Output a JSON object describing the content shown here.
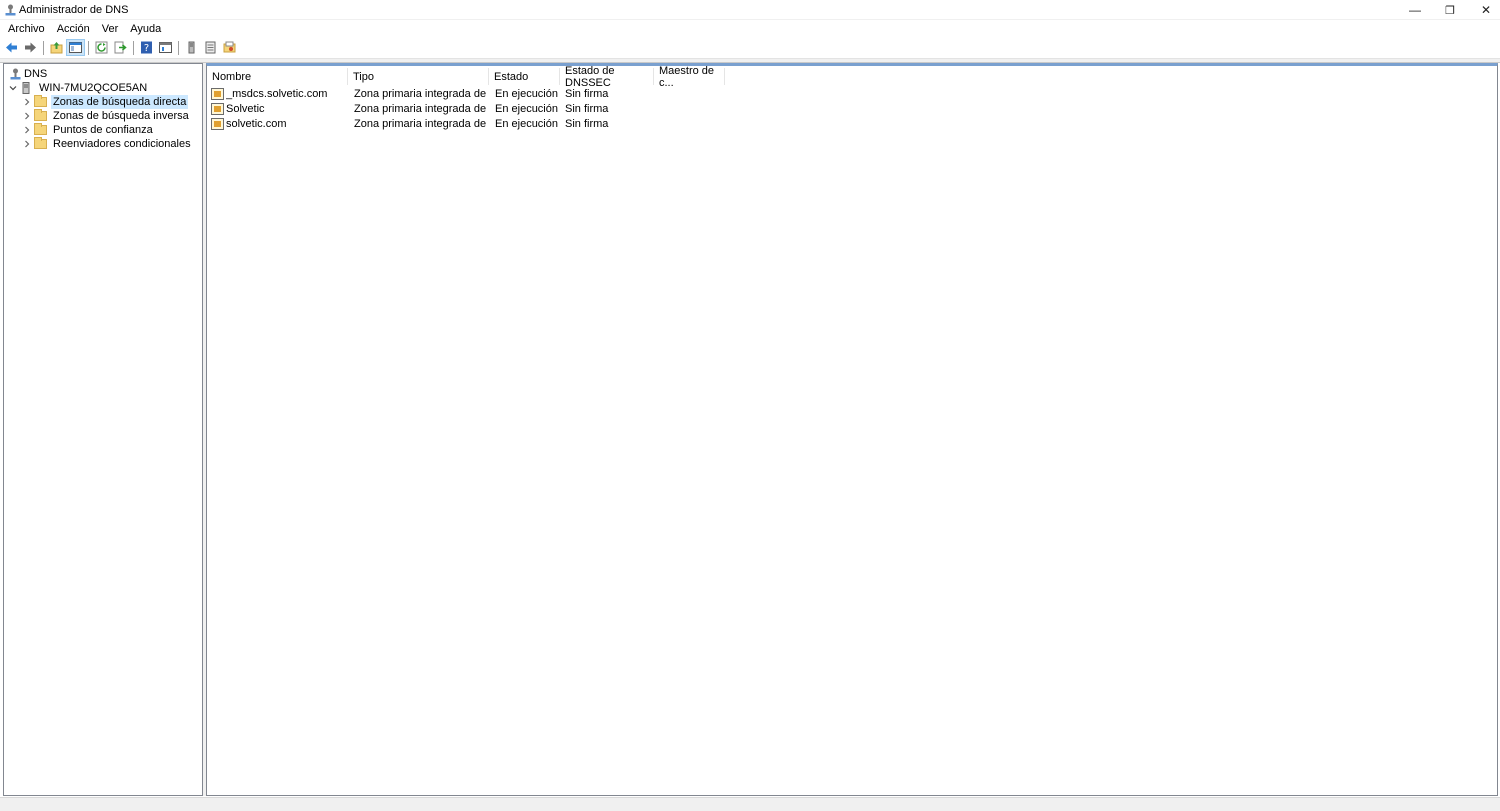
{
  "window": {
    "title": "Administrador de DNS",
    "min_glyph": "—",
    "max_glyph": "❐",
    "close_glyph": "✕"
  },
  "menu": [
    "Archivo",
    "Acción",
    "Ver",
    "Ayuda"
  ],
  "toolbar": {
    "buttons": [
      "back-icon",
      "forward-icon",
      "up-folder-icon",
      "show-hide-tree-icon",
      "refresh-icon",
      "export-list-icon",
      "help-icon",
      "properties-icon",
      "server-icon",
      "list-icon",
      "folder-icon"
    ]
  },
  "tree": {
    "root": "DNS",
    "server": "WIN-7MU2QCOE5AN",
    "items": [
      "Zonas de búsqueda directa",
      "Zonas de búsqueda inversa",
      "Puntos de confianza",
      "Reenviadores condicionales"
    ],
    "selected_index": 0
  },
  "list": {
    "columns": [
      "Nombre",
      "Tipo",
      "Estado",
      "Estado de DNSSEC",
      "Maestro de c..."
    ],
    "rows": [
      {
        "nombre": "_msdcs.solvetic.com",
        "tipo": "Zona primaria integrada de A...",
        "estado": "En ejecución",
        "dnssec": "Sin firma",
        "maestro": ""
      },
      {
        "nombre": "Solvetic",
        "tipo": "Zona primaria integrada de A...",
        "estado": "En ejecución",
        "dnssec": "Sin firma",
        "maestro": ""
      },
      {
        "nombre": "solvetic.com",
        "tipo": "Zona primaria integrada de A...",
        "estado": "En ejecución",
        "dnssec": "Sin firma",
        "maestro": ""
      }
    ]
  },
  "colors": {
    "selection": "#cce8ff",
    "accent_blue": "#2f7fd4",
    "folder": "#f5d57a"
  }
}
